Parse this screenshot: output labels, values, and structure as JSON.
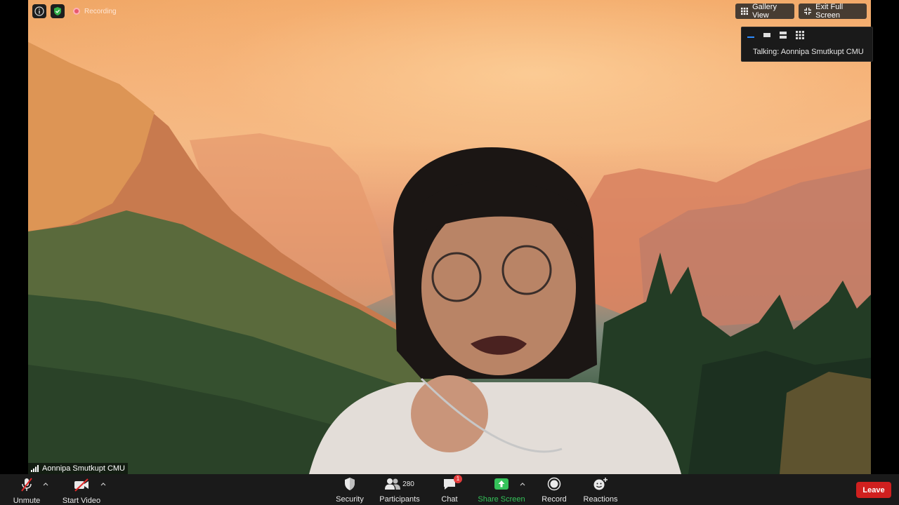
{
  "top_left": {
    "recording_label": "Recording"
  },
  "top_right": {
    "gallery_view_label": "Gallery View",
    "exit_full_screen_label": "Exit Full Screen",
    "talking_label": "Talking: Aonnipa Smutkupt CMU"
  },
  "participant": {
    "name": "Aonnipa Smutkupt CMU"
  },
  "toolbar": {
    "unmute_label": "Unmute",
    "start_video_label": "Start Video",
    "security_label": "Security",
    "participants_label": "Participants",
    "participants_count": "280",
    "chat_label": "Chat",
    "chat_badge": "1",
    "share_screen_label": "Share Screen",
    "record_label": "Record",
    "reactions_label": "Reactions",
    "leave_label": "Leave"
  },
  "colors": {
    "toolbar_bg": "#1a1a1a",
    "share_green": "#35c35a",
    "leave_red": "#d0201f",
    "badge_red": "#e53d3d"
  },
  "icons": [
    "info-icon",
    "shield-icon",
    "recording-icon",
    "gallery-grid-icon",
    "exit-fullscreen-icon",
    "signal-icon",
    "mic-off-icon",
    "video-off-icon",
    "security-shield-icon",
    "participants-icon",
    "chat-icon",
    "share-screen-icon",
    "record-icon",
    "reactions-icon"
  ]
}
